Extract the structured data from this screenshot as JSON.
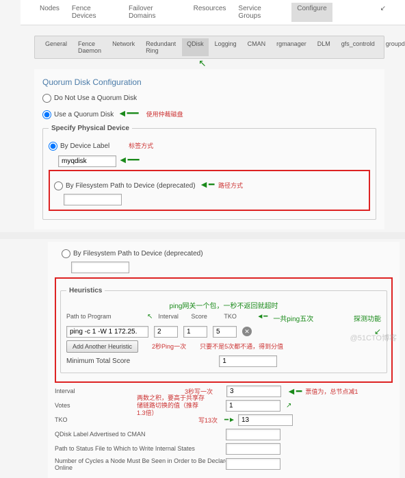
{
  "topnav": {
    "items": [
      "Nodes",
      "Fence Devices",
      "Failover Domains",
      "Resources",
      "Service Groups",
      "Configure"
    ],
    "active": 5
  },
  "subnav": {
    "items": [
      "General",
      "Fence Daemon",
      "Network",
      "Redundant Ring",
      "QDisk",
      "Logging",
      "CMAN",
      "rgmanager",
      "DLM",
      "gfs_controld",
      "groupd"
    ],
    "active": 4
  },
  "title": "Quorum Disk Configuration",
  "quorum": {
    "opt_no": "Do Not Use a Quorum Disk",
    "opt_yes": "Use a Quorum Disk"
  },
  "ann": {
    "use_qdisk": "使用仲裁磁盘",
    "label_way": "标签方式",
    "path_way": "路径方式",
    "ping_desc": "ping网关一个包，一秒不返回就超时",
    "ping5": "一共ping五次",
    "probe": "探测功能",
    "ping2s": "2秒Ping一次",
    "tko_fail": "只要不是5次都不通，得到分值",
    "write3s": "3秒写一次",
    "write13": "写13次",
    "product": "两数之积，要高于共享存储链路切换的值（推荐1.3倍）",
    "votes": "票值为，总节点减1"
  },
  "spd": {
    "legend": "Specify Physical Device",
    "by_label": "By Device Label",
    "label_val": "myqdisk",
    "by_path": "By Filesystem Path to Device (deprecated)",
    "path_val": ""
  },
  "heur": {
    "legend": "Heuristics",
    "h_path": "Path to Program",
    "h_int": "Interval",
    "h_score": "Score",
    "h_tko": "TKO",
    "row": {
      "path": "ping -c 1 -W 1 172.25.",
      "int": "2",
      "score": "1",
      "tko": "5"
    },
    "add_btn": "Add Another Heuristic",
    "min_label": "Minimum Total Score",
    "min_val": "1"
  },
  "bottom": {
    "interval": {
      "lbl": "Interval",
      "val": "3"
    },
    "votes": {
      "lbl": "Votes",
      "val": "1"
    },
    "tko": {
      "lbl": "TKO",
      "val": "13"
    },
    "qlabel": "QDisk Label Advertised to CMAN",
    "status": "Path to Status File to Which to Write Internal States",
    "cycles": "Number of Cycles a Node Must Be Seen in Order to Be Declared Online"
  },
  "watermark": "@51CTO博客"
}
